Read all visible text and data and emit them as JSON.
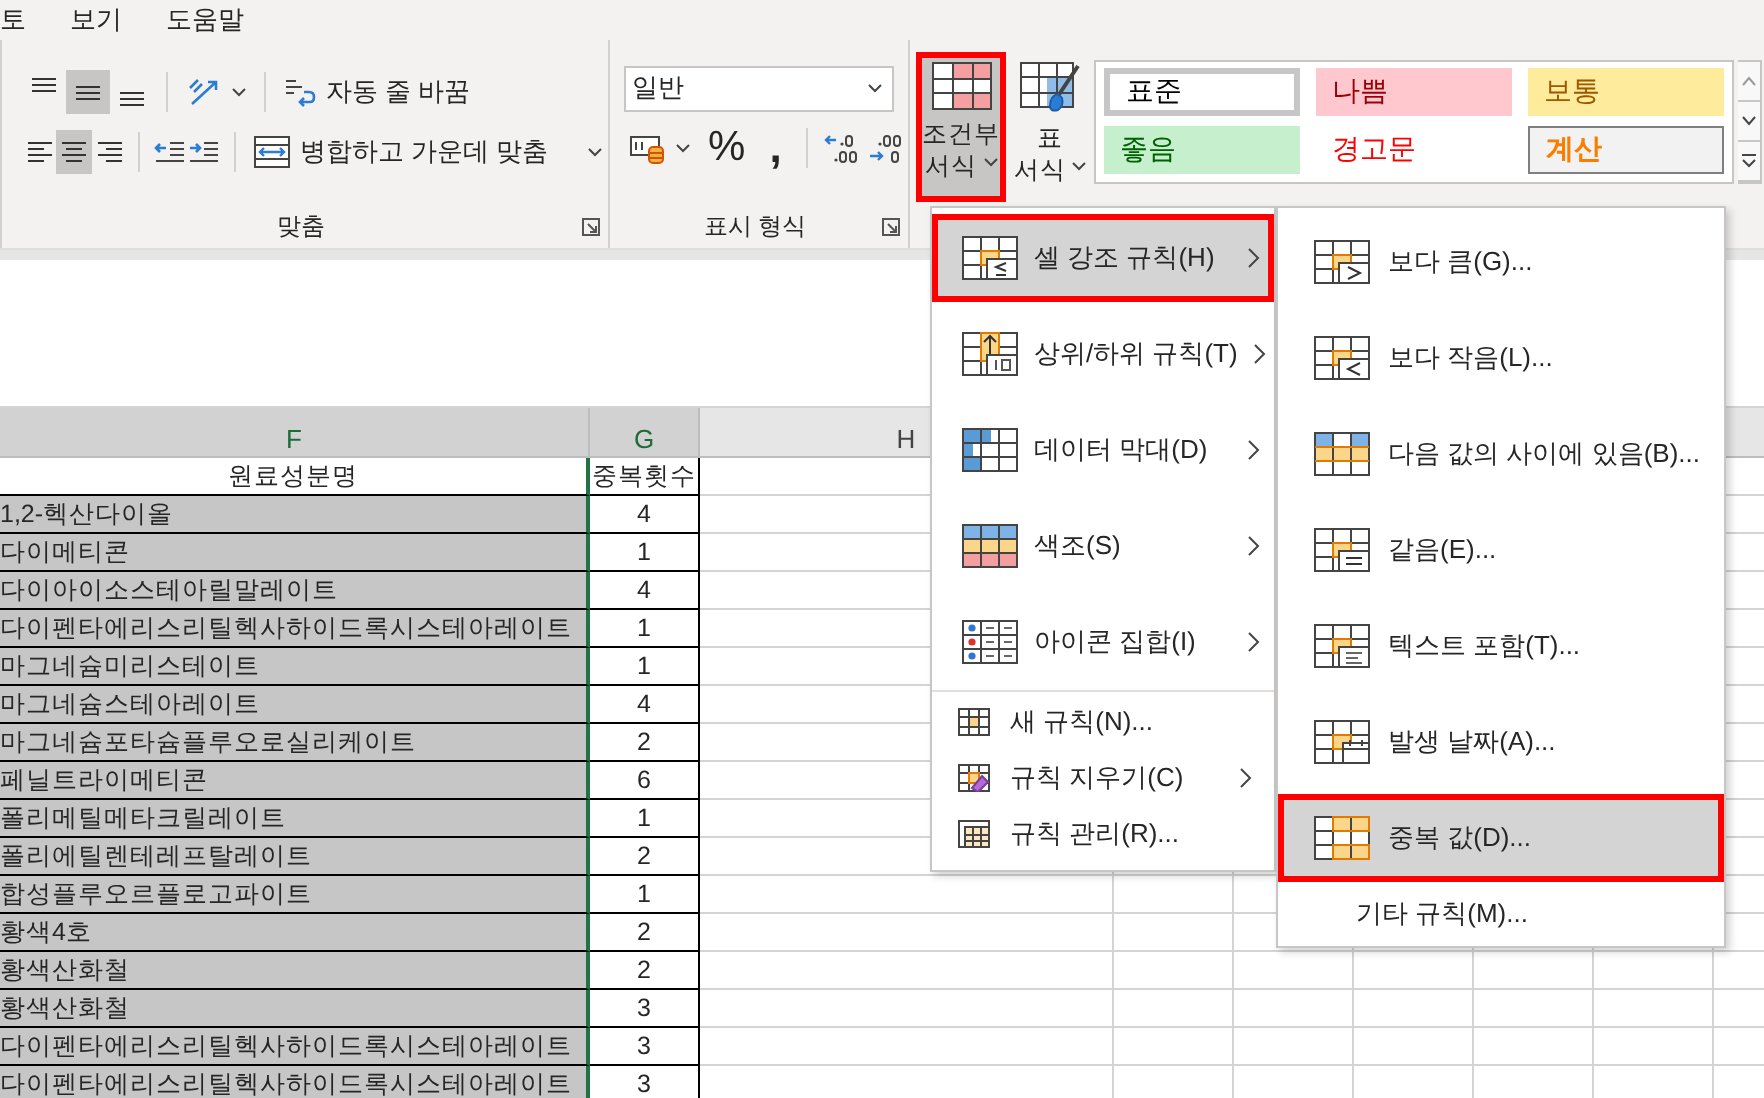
{
  "menu_tabs": [
    {
      "label": "토"
    },
    {
      "label": "보기"
    },
    {
      "label": "도움말"
    }
  ],
  "alignment": {
    "title": "맞춤",
    "vertical": [
      {
        "selected": false
      },
      {
        "selected": true
      },
      {
        "selected": false
      }
    ],
    "horizontal": [
      {
        "selected": false
      },
      {
        "selected": true
      },
      {
        "selected": false
      }
    ],
    "wrap_text": "자동 줄 바꿈",
    "merge_center": "병합하고 가운데 맞춤"
  },
  "number": {
    "title": "표시 형식",
    "format": "일반",
    "percent": "%",
    "comma": ","
  },
  "styles": {
    "conditional_formatting": {
      "lines": [
        "조건부",
        "서식"
      ],
      "selected": true
    },
    "format_as_table": {
      "lines": [
        "표",
        "서식"
      ]
    },
    "cell_styles": [
      {
        "label": "표준",
        "kind": "normal"
      },
      {
        "label": "나쁨",
        "kind": "bad"
      },
      {
        "label": "보통",
        "kind": "neutral"
      },
      {
        "label": "좋음",
        "kind": "good"
      },
      {
        "label": "경고문",
        "kind": "warning"
      },
      {
        "label": "계산",
        "kind": "calculation"
      }
    ]
  },
  "sheet": {
    "columns": [
      {
        "label": "F",
        "selected": true
      },
      {
        "label": "G",
        "selected": true
      },
      {
        "label": "H",
        "selected": false
      }
    ],
    "header": [
      "원료성분명",
      "중복횟수"
    ],
    "rows": [
      [
        "1,2-헥산다이올",
        "4"
      ],
      [
        "다이메티콘",
        "1"
      ],
      [
        "다이아이소스테아릴말레이트",
        "4"
      ],
      [
        "다이펜타에리스리틸헥사하이드록시스테아레이트",
        "1"
      ],
      [
        "마그네슘미리스테이트",
        "1"
      ],
      [
        "마그네슘스테아레이트",
        "4"
      ],
      [
        "마그네슘포타슘플루오로실리케이트",
        "2"
      ],
      [
        "페닐트라이메티콘",
        "6"
      ],
      [
        "폴리메틸메타크릴레이트",
        "1"
      ],
      [
        "폴리에틸렌테레프탈레이트",
        "2"
      ],
      [
        "합성플루오르플로고파이트",
        "1"
      ],
      [
        "황색4호",
        "2"
      ],
      [
        "황색산화철",
        "2"
      ],
      [
        "황색산화철",
        "3"
      ],
      [
        "다이펜타에리스리틸헥사하이드록시스테아레이트",
        "3"
      ],
      [
        "다이펜타에리스리틸헥사하이드록시스테아레이트",
        "3"
      ]
    ]
  },
  "menu": {
    "items": [
      {
        "label": "셀 강조 규칙(H)",
        "kind": "large",
        "submenu": true,
        "selected": true
      },
      {
        "label": "상위/하위 규칙(T)",
        "kind": "large",
        "submenu": true,
        "selected": false
      },
      {
        "label": "데이터 막대(D)",
        "kind": "large",
        "submenu": true,
        "selected": false
      },
      {
        "label": "색조(S)",
        "kind": "large",
        "submenu": true,
        "selected": false
      },
      {
        "label": "아이콘 집합(I)",
        "kind": "large",
        "submenu": true,
        "selected": false
      },
      {
        "label": "새 규칙(N)...",
        "kind": "small",
        "submenu": false,
        "selected": false
      },
      {
        "label": "규칙 지우기(C)",
        "kind": "small",
        "submenu": true,
        "selected": false
      },
      {
        "label": "규칙 관리(R)...",
        "kind": "small",
        "submenu": false,
        "selected": false
      }
    ]
  },
  "submenu": {
    "items": [
      {
        "label": "보다 큼(G)...",
        "kind": "large",
        "selected": false
      },
      {
        "label": "보다 작음(L)...",
        "kind": "large",
        "selected": false
      },
      {
        "label": "다음 값의 사이에 있음(B)...",
        "kind": "large",
        "selected": false
      },
      {
        "label": "같음(E)...",
        "kind": "large",
        "selected": false
      },
      {
        "label": "텍스트 포함(T)...",
        "kind": "large",
        "selected": false
      },
      {
        "label": "발생 날짜(A)...",
        "kind": "large",
        "selected": false
      },
      {
        "label": "중복 값(D)...",
        "kind": "large",
        "selected": true
      },
      {
        "label": "기타 규칙(M)...",
        "kind": "small",
        "selected": false
      }
    ]
  }
}
